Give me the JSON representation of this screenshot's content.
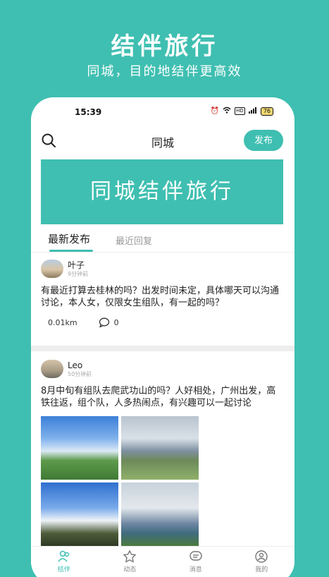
{
  "promo": {
    "title": "结伴旅行",
    "subtitle": "同城，目的地结伴更高效"
  },
  "status_bar": {
    "time": "15:39",
    "network_label": "HD",
    "battery": "76"
  },
  "nav": {
    "title": "同城",
    "publish_label": "发布"
  },
  "banner": {
    "text": "同城结伴旅行"
  },
  "tabs": [
    {
      "label": "最新发布",
      "active": true
    },
    {
      "label": "最近回复",
      "active": false
    }
  ],
  "posts": [
    {
      "author": "叶子",
      "time": "9分钟前",
      "content": "有最近打算去桂林的吗？出发时间未定，具体哪天可以沟通讨论，本人女，仅限女生组队，有一起的吗？",
      "distance": "0.01km",
      "comments": "0"
    },
    {
      "author": "Leo",
      "time": "50分钟前",
      "content": "8月中旬有组队去爬武功山的吗？人好相处，广州出发，高铁往返，组个队，人多热闹点，有兴趣可以一起讨论"
    }
  ],
  "tabbar": [
    {
      "label": "结伴",
      "icon": "people-icon",
      "active": true
    },
    {
      "label": "动态",
      "icon": "star-face-icon",
      "active": false
    },
    {
      "label": "消息",
      "icon": "chat-icon",
      "active": false
    },
    {
      "label": "我的",
      "icon": "user-icon",
      "active": false
    }
  ],
  "colors": {
    "accent": "#3fbfb1"
  }
}
